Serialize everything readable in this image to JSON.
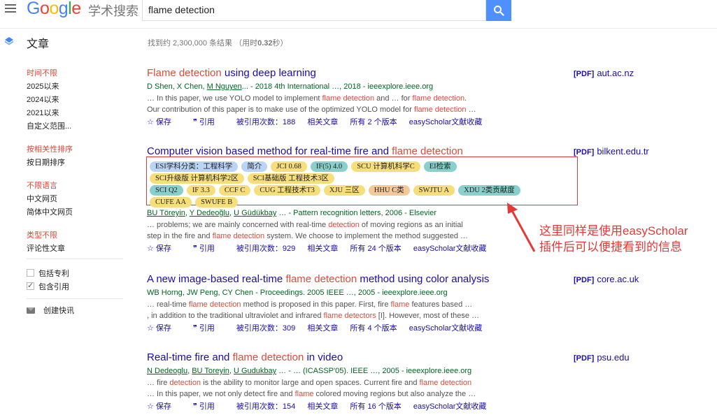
{
  "header": {
    "logo": "Google",
    "logo_sub": "学术搜索",
    "search_value": "flame detection"
  },
  "subheader": {
    "section_label": "文章",
    "result_stats_prefix": "找到约 2,300,000 条结果 （用时",
    "result_stats_time": "0.32",
    "result_stats_suffix": "秒）"
  },
  "sidebar": {
    "time": [
      "时间不限",
      "2025以来",
      "2024以来",
      "2021以来",
      "自定义范围..."
    ],
    "sort": [
      "按相关性排序",
      "按日期排序"
    ],
    "language": [
      "不限语言",
      "中文网页",
      "简体中文网页"
    ],
    "type": [
      "类型不限",
      "评论性文章"
    ],
    "include_patents": "包括专利",
    "include_citations": "包含引用",
    "create_alert": "创建快讯"
  },
  "actions": {
    "save": "保存",
    "cite": "引用",
    "related": "相关文章",
    "easyscholar": "easyScholar文献收藏"
  },
  "results": [
    {
      "title_a": "Flame detection",
      "title_b": " using deep learning",
      "authors_pre": "D Shen, X Chen, ",
      "authors_link": "M Nguyen",
      "authors_post": "... - 2018 4th International …, 2018 - ieeexplore.ieee.org",
      "snippet1_a": "… In this paper, we use YOLO model to implement ",
      "snippet1_h": "flame detection",
      "snippet1_b": " and … for ",
      "snippet1_h2": "flame detection",
      "snippet1_c": ".",
      "snippet2_a": "Our contribution of this paper is to make use of the optimized YOLO model for ",
      "snippet2_h": "flame detection",
      "snippet2_b": " …",
      "cited": "被引用次数：188",
      "versions": "所有 2 个版本",
      "pdf_tag": "[PDF]",
      "pdf_site": "aut.ac.nz"
    },
    {
      "title_a": "Computer vision based method for real-time fire and ",
      "title_b": "flame detection",
      "authors_link1": "BU Töreyin",
      "authors_link2": "Y Dedeoğlu",
      "authors_link3": "U Güdükbay",
      "authors_post": "… - Pattern recognition letters, 2006 - Elsevier",
      "snippet1_a": "… problems; we are mainly concerned with real-time ",
      "snippet1_h": "detection",
      "snippet1_b": " of moving regions as an initial",
      "snippet2_a": "step in the fire and ",
      "snippet2_h": "flame detection",
      "snippet2_b": " system. We choose to implement the method suggested …",
      "cited": "被引用次数：929",
      "versions": "所有 24 个版本",
      "pdf_tag": "[PDF]",
      "pdf_site": "bilkent.edu.tr"
    },
    {
      "title_a": "A new image-based real-time ",
      "title_b": "flame detection",
      "title_c": " method using color analysis",
      "authors_text": "WB Horng, JW Peng, CY Chen - Proceedings. 2005 IEEE …, 2005 - ieeexplore.ieee.org",
      "snippet1_a": "… real-time ",
      "snippet1_h": "flame detection",
      "snippet1_b": " method is proposed in this paper. First, fire ",
      "snippet1_h2": "flame",
      "snippet1_c": " features based …",
      "snippet2_a": ", in addition to the traditional ultraviolet and infrared ",
      "snippet2_h": "flame detectors",
      "snippet2_b": " [I]. However, most of these …",
      "cited": "被引用次数：309",
      "versions": "所有 4 个版本",
      "pdf_tag": "[PDF]",
      "pdf_site": "core.ac.uk"
    },
    {
      "title_a": "Real-time fire and ",
      "title_b": "flame detection",
      "title_c": " in video",
      "authors_link1": "N Dedeoglu",
      "authors_link2": "BU Toreyin",
      "authors_link3": "U Gudukbay",
      "authors_post": "… - … (ICASSP'05). IEEE …, 2005 - ieeexplore.ieee.org",
      "snippet1_a": "… fire ",
      "snippet1_h": "detection",
      "snippet1_b": " is the ability to monitor large and open spaces. Current fire and ",
      "snippet1_h2": "flame detection",
      "snippet2_a": "… In this paper, we not only detect fire and ",
      "snippet2_h": "flame",
      "snippet2_b": " colored moving regions but also analyze the …",
      "cited": "被引用次数：154",
      "versions": "所有 16 个版本",
      "pdf_tag": "[PDF]",
      "pdf_site": "psu.edu"
    }
  ],
  "badges": {
    "row1": [
      "ESI学科分类：工程科学",
      "简介",
      "JCI 0.68",
      "IF(5) 4.0",
      "SCU 计算机科学C",
      "EI检索"
    ],
    "row2": [
      "SCI升级版 计算机科学2区",
      "SCI基础版 工程技术3区"
    ],
    "row3": [
      "SCI Q2",
      "IF 3.3",
      "CCF C",
      "CUG 工程技术T3",
      "XJU 三区",
      "HHU C类",
      "SWJTU A",
      "XDU 2类贡献度"
    ],
    "row4": [
      "CUFE AA",
      "SWUFE B"
    ]
  },
  "annotation": {
    "line1": "这里同样是使用easyScholar",
    "line2": "插件后可以便捷看到的信息"
  },
  "colors": {
    "link": "#1a0dab",
    "highlight": "#dd4b39",
    "author_green": "#006621",
    "annotation_red": "#e53935",
    "search_blue": "#4d90fe"
  }
}
